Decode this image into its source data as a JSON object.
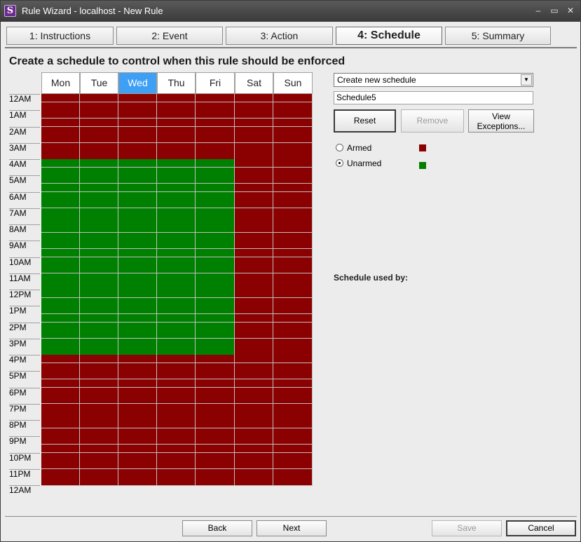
{
  "window": {
    "title": "Rule Wizard - localhost - New Rule",
    "app_icon_letter": "S",
    "controls": {
      "minimize": "‒",
      "maximize": "▭",
      "close": "✕"
    }
  },
  "tabs": [
    {
      "label": "1: Instructions",
      "active": false
    },
    {
      "label": "2: Event",
      "active": false
    },
    {
      "label": "3: Action",
      "active": false
    },
    {
      "label": "4: Schedule",
      "active": true
    },
    {
      "label": "5: Summary",
      "active": false
    }
  ],
  "heading": "Create a schedule to control when this rule should be enforced",
  "schedule_grid": {
    "days": [
      "Mon",
      "Tue",
      "Wed",
      "Thu",
      "Fri",
      "Sat",
      "Sun"
    ],
    "selected_day": "Wed",
    "hour_labels": [
      "12AM",
      "1AM",
      "2AM",
      "3AM",
      "4AM",
      "5AM",
      "6AM",
      "7AM",
      "8AM",
      "9AM",
      "10AM",
      "11AM",
      "12PM",
      "1PM",
      "2PM",
      "3PM",
      "4PM",
      "5PM",
      "6PM",
      "7PM",
      "8PM",
      "9PM",
      "10PM",
      "11PM",
      "12AM"
    ],
    "slots_per_hour": 2,
    "unarmed_window": {
      "days": [
        "Mon",
        "Tue",
        "Wed",
        "Thu",
        "Fri"
      ],
      "from_hour": 4,
      "to_hour": 16
    },
    "colors": {
      "armed": "#8b0000",
      "unarmed": "#008000"
    }
  },
  "schedule_select": {
    "value": "Create new schedule"
  },
  "schedule_name": {
    "value": "Schedule5"
  },
  "buttons": {
    "reset": "Reset",
    "remove": "Remove",
    "view_exceptions_line1": "View",
    "view_exceptions_line2": "Exceptions..."
  },
  "legend": {
    "armed_label": "Armed",
    "unarmed_label": "Unarmed",
    "selected": "Unarmed"
  },
  "schedule_used_by_label": "Schedule used by:",
  "footer": {
    "back": "Back",
    "next": "Next",
    "save": "Save",
    "cancel": "Cancel"
  }
}
